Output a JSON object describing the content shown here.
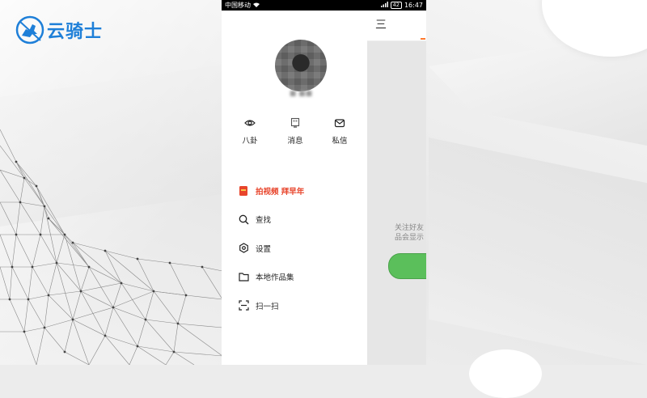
{
  "logo": {
    "text": "云骑士",
    "color": "#1e7fd8"
  },
  "statusbar": {
    "carrier": "中国移动",
    "battery": "42",
    "time": "16:47"
  },
  "profile": {
    "username": "■ ■■"
  },
  "quick_actions": [
    {
      "label": "八卦",
      "icon": "eye-icon"
    },
    {
      "label": "消息",
      "icon": "message-icon"
    },
    {
      "label": "私信",
      "icon": "mail-icon"
    }
  ],
  "menu": [
    {
      "label": "拍视频 拜早年",
      "icon": "red-envelope-icon",
      "promo": true
    },
    {
      "label": "查找",
      "icon": "search-icon"
    },
    {
      "label": "设置",
      "icon": "settings-icon"
    },
    {
      "label": "本地作品集",
      "icon": "folder-icon"
    },
    {
      "label": "扫一扫",
      "icon": "scan-icon"
    }
  ],
  "right_panel": {
    "menu_glyph": "三",
    "text_line1": "关注好友",
    "text_line2": "品会显示",
    "accent_color": "#ff7a2e",
    "button_color": "#5bbf5b"
  }
}
